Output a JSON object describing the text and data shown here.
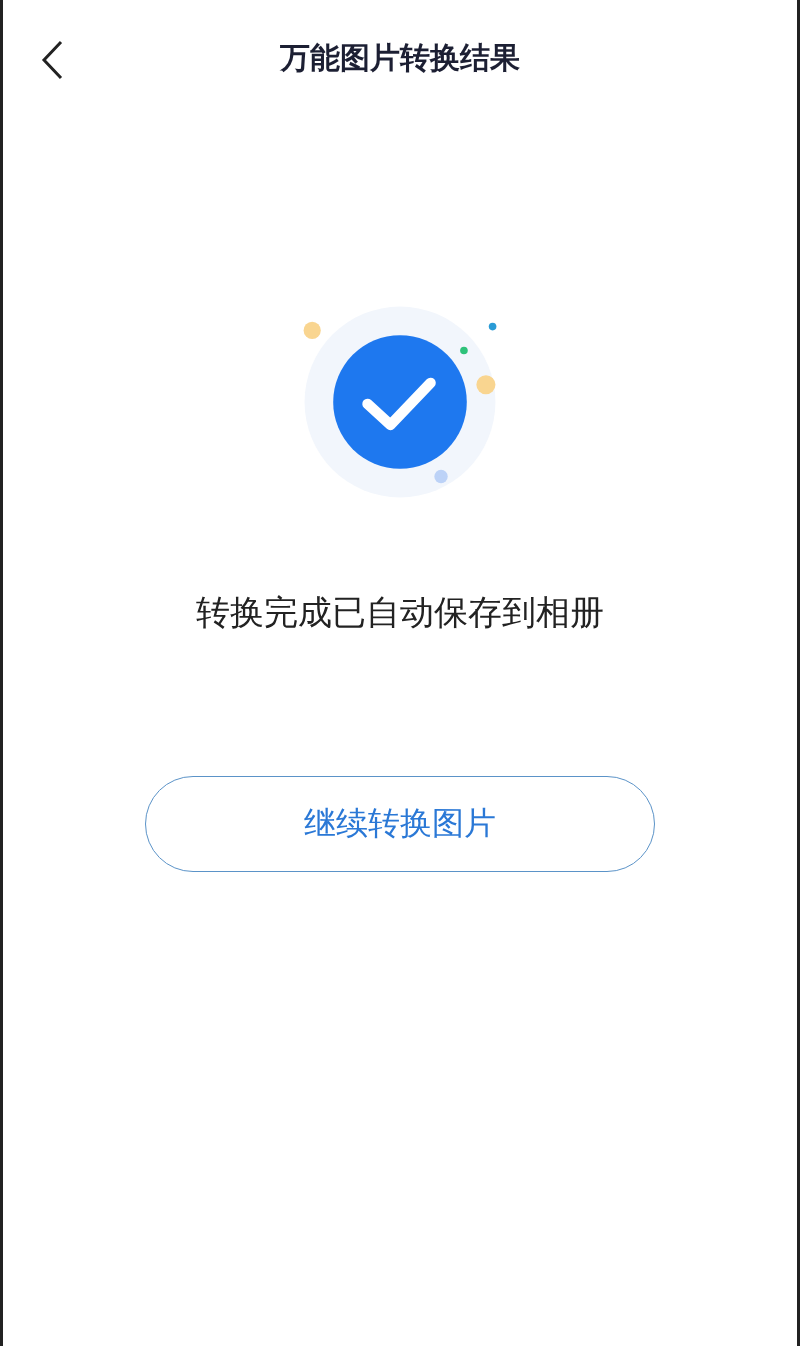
{
  "header": {
    "title": "万能图片转换结果"
  },
  "message": "转换完成已自动保存到相册",
  "button": {
    "label": "继续转换图片"
  }
}
